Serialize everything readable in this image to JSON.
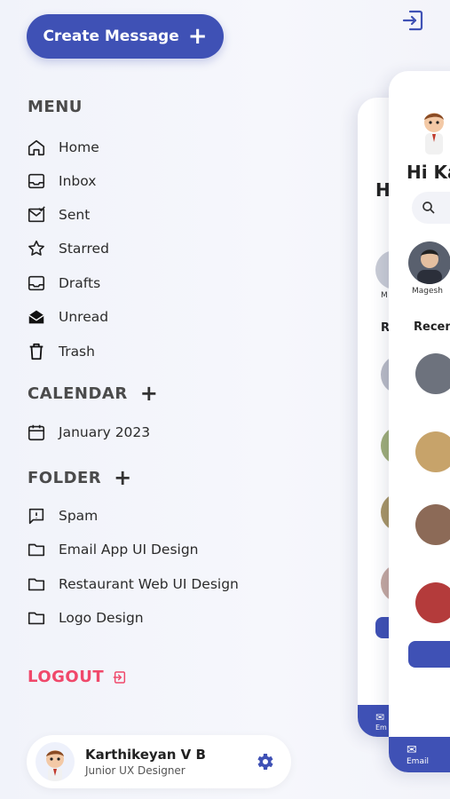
{
  "create_button": {
    "label": "Create Message"
  },
  "menu": {
    "title": "MENU",
    "items": [
      {
        "label": "Home",
        "icon": "home-icon"
      },
      {
        "label": "Inbox",
        "icon": "inbox-icon"
      },
      {
        "label": "Sent",
        "icon": "sent-icon"
      },
      {
        "label": "Starred",
        "icon": "star-icon"
      },
      {
        "label": "Drafts",
        "icon": "drafts-icon"
      },
      {
        "label": "Unread",
        "icon": "envelope-open-icon"
      },
      {
        "label": "Trash",
        "icon": "trash-icon"
      }
    ]
  },
  "calendar": {
    "title": "CALENDAR",
    "items": [
      {
        "label": "January 2023",
        "icon": "calendar-icon"
      }
    ]
  },
  "folder": {
    "title": "FOLDER",
    "items": [
      {
        "label": "Spam",
        "icon": "spam-icon"
      },
      {
        "label": "Email App UI Design",
        "icon": "folder-icon"
      },
      {
        "label": "Restaurant Web UI Design",
        "icon": "folder-icon"
      },
      {
        "label": "Logo Design",
        "icon": "folder-icon"
      }
    ]
  },
  "logout": {
    "label": "LOGOUT"
  },
  "profile": {
    "name": "Karthikeyan V B",
    "role": "Junior UX Designer"
  },
  "preview": {
    "greeting_front": "Hi Ka",
    "greeting_back": "H",
    "contact_name": "Magesh",
    "contact_name_back": "M",
    "recent_front": "Recen",
    "recent_back": "R",
    "nav_label": "Email",
    "nav_label_back": "Em"
  },
  "colors": {
    "accent": "#3f51b5",
    "logout": "#f0486a",
    "background": "#f3f4fa"
  }
}
